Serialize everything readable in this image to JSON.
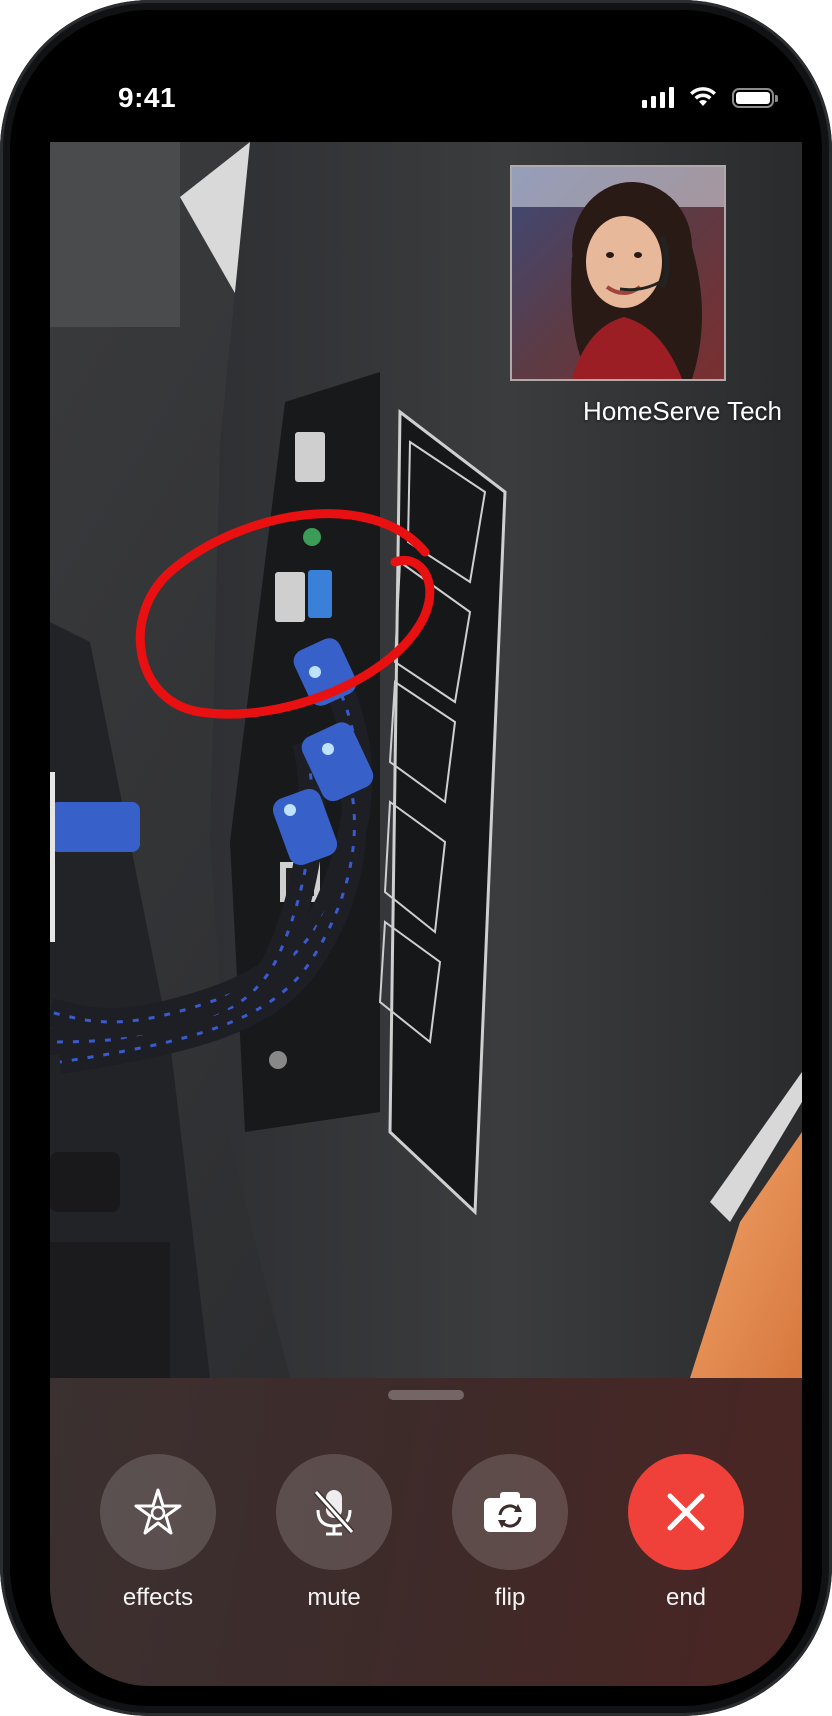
{
  "status_bar": {
    "time": "9:41",
    "battery_level": 1.0,
    "icons": [
      "cellular-signal-icon",
      "wifi-icon",
      "battery-icon"
    ]
  },
  "remote_participant": {
    "name": "HomeServe Tech"
  },
  "annotation": {
    "color": "#e81010",
    "shape": "freehand-circle"
  },
  "controls": [
    {
      "id": "effects",
      "label": "effects",
      "icon": "star-effects-icon"
    },
    {
      "id": "mute",
      "label": "mute",
      "icon": "microphone-muted-icon"
    },
    {
      "id": "flip",
      "label": "flip",
      "icon": "camera-flip-icon"
    },
    {
      "id": "end",
      "label": "end",
      "icon": "close-x-icon",
      "color": "#f0403a"
    }
  ]
}
